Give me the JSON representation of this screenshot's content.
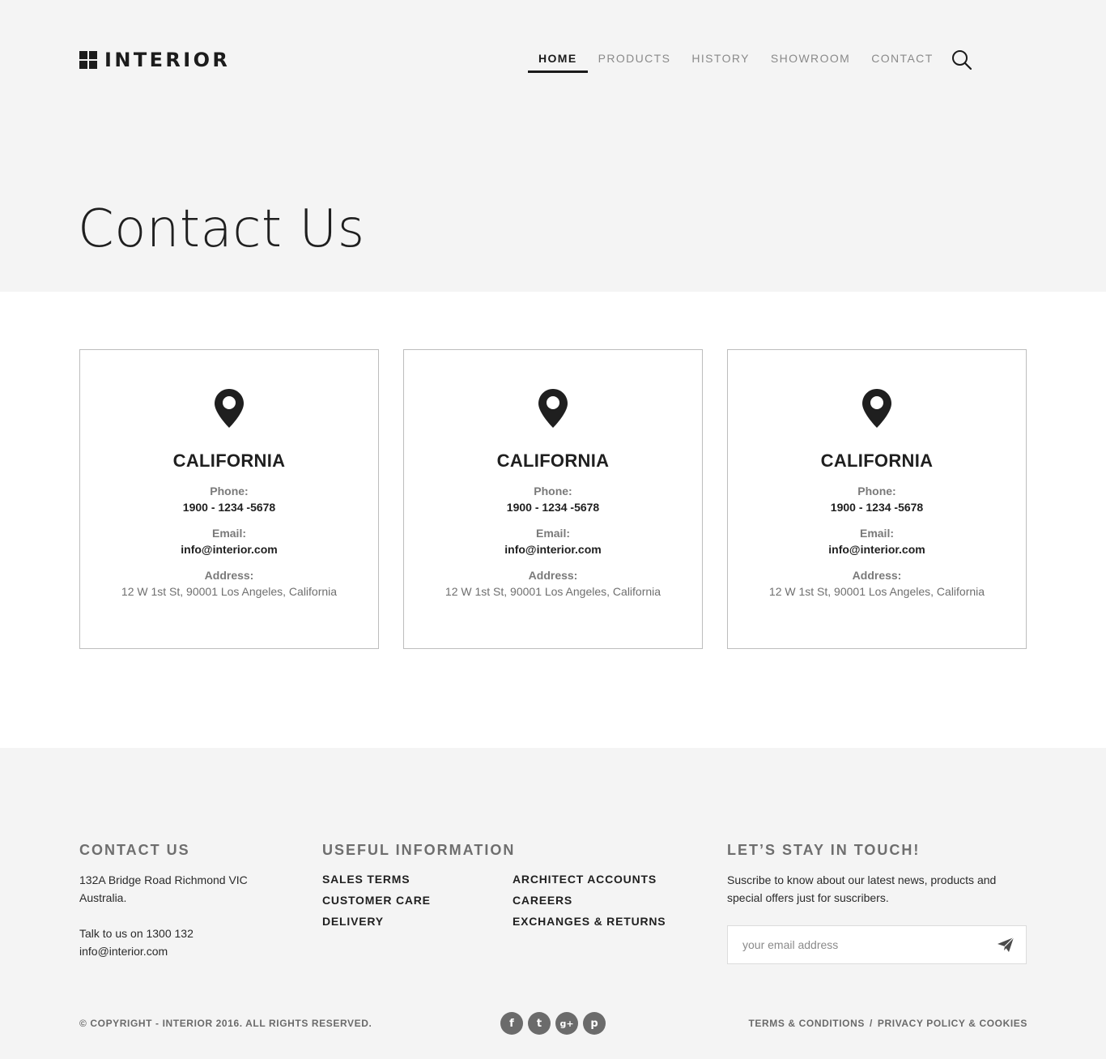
{
  "brand": {
    "name": "INTERIOR"
  },
  "nav": {
    "items": [
      {
        "label": "HOME",
        "active": true
      },
      {
        "label": "PRODUCTS",
        "active": false
      },
      {
        "label": "HISTORY",
        "active": false
      },
      {
        "label": "SHOWROOM",
        "active": false
      },
      {
        "label": "CONTACT",
        "active": false
      }
    ],
    "search_icon": "search-icon"
  },
  "page": {
    "title": "Contact Us"
  },
  "locations": [
    {
      "city": "CALIFORNIA",
      "phone_label": "Phone:",
      "phone": "1900 - 1234 -5678",
      "email_label": "Email:",
      "email": "info@interior.com",
      "address_label": "Address:",
      "address": "12 W 1st St, 90001 Los Angeles, California",
      "icon": "map-pin-icon"
    },
    {
      "city": "CALIFORNIA",
      "phone_label": "Phone:",
      "phone": "1900 - 1234 -5678",
      "email_label": "Email:",
      "email": "info@interior.com",
      "address_label": "Address:",
      "address": "12 W 1st St, 90001 Los Angeles, California",
      "icon": "map-pin-icon"
    },
    {
      "city": "CALIFORNIA",
      "phone_label": "Phone:",
      "phone": "1900 - 1234 -5678",
      "email_label": "Email:",
      "email": "info@interior.com",
      "address_label": "Address:",
      "address": "12 W 1st St, 90001 Los Angeles, California",
      "icon": "map-pin-icon"
    }
  ],
  "footer": {
    "contact": {
      "heading": "CONTACT US",
      "address_line1": "132A Bridge Road Richmond VIC",
      "address_line2": "Australia.",
      "phone_line": "Talk to us on 1300 132",
      "email": "info@interior.com"
    },
    "useful": {
      "heading": "USEFUL INFORMATION",
      "col1": [
        "SALES TERMS",
        "CUSTOMER CARE",
        "DELIVERY"
      ],
      "col2": [
        "ARCHITECT ACCOUNTS",
        "CAREERS",
        "EXCHANGES & RETURNS"
      ]
    },
    "newsletter": {
      "heading": "LET’S STAY IN TOUCH!",
      "text_line1": "Suscribe to know about our latest news, products and",
      "text_line2": "special offers just for suscribers.",
      "placeholder": "your email address",
      "send_icon": "paper-plane-icon"
    },
    "copyright": "© COPYRIGHT - INTERIOR 2016. ALL RIGHTS RESERVED.",
    "socials": [
      {
        "icon": "facebook-icon",
        "glyph": "f"
      },
      {
        "icon": "twitter-icon",
        "glyph": "t"
      },
      {
        "icon": "google-plus-icon",
        "glyph": "g+"
      },
      {
        "icon": "pinterest-icon",
        "glyph": "p"
      }
    ],
    "legal": {
      "terms": "TERMS & CONDITIONS",
      "separator": "/",
      "privacy": "PRIVACY POLICY & COOKIES"
    }
  }
}
